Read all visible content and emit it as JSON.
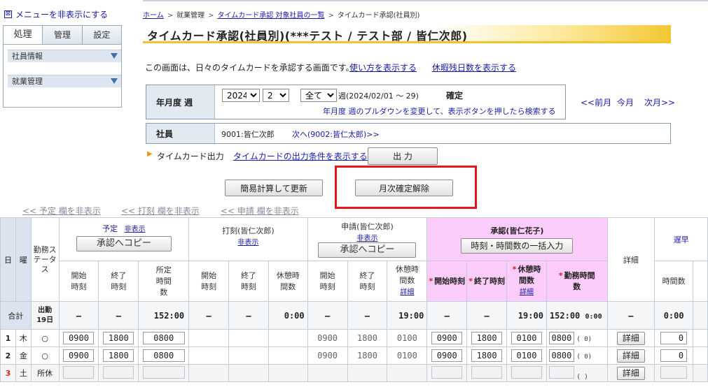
{
  "sidebar": {
    "toggle_label": "メニューを非表示にする",
    "tabs": [
      "処理",
      "管理",
      "設定"
    ],
    "items": [
      "社員情報",
      "就業管理"
    ]
  },
  "breadcrumb": {
    "home": "ホーム",
    "level1": "就業管理",
    "level2": "タイムカード承認 対象社員の一覧",
    "current": "タイムカード承認(社員別)",
    "separator": ">"
  },
  "page_title": "タイムカード承認(社員別)(***テスト / テスト部 / 皆仁次郎)",
  "description": "この画面は、日々のタイムカードを承認する画面です。",
  "links": {
    "how_to": "使い方を表示する",
    "leave_days": "休暇残日数を表示する",
    "output_conditions": "タイムカードの出力条件を表示する"
  },
  "filter": {
    "period_label": "年月度 週",
    "year": "2024",
    "month": "2",
    "week": "全て",
    "range_text": "週(2024/02/01 〜 29)",
    "status": "確定",
    "hint": "年月度 週のプルダウンを変更して、表示ボタンを押したら検索する",
    "prev_month": "<<前月",
    "this_month": "今月",
    "next_month": "次月>>",
    "employee_label": "社員",
    "employee": "9001:皆仁次郎",
    "next_employee": "次へ(9002:皆仁太郎)>>"
  },
  "output": {
    "label": "タイムカード出力",
    "button": "出 力"
  },
  "buttons": {
    "simple_calc": "簡易計算して更新",
    "unlock_month": "月次確定解除"
  },
  "column_toggles": {
    "plan": "<< 予定 欄を非表示",
    "punch": "<< 打刻 欄を非表示",
    "apply": "<< 申請 欄を非表示"
  },
  "grid": {
    "headers": {
      "day": "日",
      "weekday": "曜",
      "status": "勤務ステータス",
      "plan_title": "予定",
      "hide": "非表示",
      "copy_to_approve": "承認へコピー",
      "punch_title": "打刻(皆仁次郎)",
      "apply_title": "申請(皆仁次郎)",
      "approve_title": "承認(皆仁花子)",
      "bulk_input": "時刻・時間数の一括入力",
      "detail": "詳細",
      "late": "遅早",
      "start": "開始時刻",
      "end": "終了時刻",
      "scheduled": "所定時間数",
      "break_hours": "休憩時間数",
      "break_detail": "詳細",
      "work_hours": "勤務時間数",
      "hours": "時間数",
      "star": "*"
    },
    "totals": {
      "label": "合計",
      "attend_label": "出勤",
      "attend_days": "19日",
      "dash": "–",
      "plan_scheduled": "152:00",
      "punch_break": "0:00",
      "apply_break": "19:00",
      "approve_break": "19:00",
      "approve_work": "152:00",
      "approve_work_sub": "0:00",
      "late": "0:00"
    },
    "rows": [
      {
        "day": "1",
        "weekday": "木",
        "status": "○",
        "plan_start": "0900",
        "plan_end": "1800",
        "plan_sched": "0800",
        "apply_start": "0900",
        "apply_end": "1800",
        "apply_break": "0100",
        "appr_start": "0900",
        "appr_end": "1800",
        "appr_break": "0100",
        "appr_work": "0800",
        "paren": "( 0)",
        "detail": "詳細",
        "late": "0"
      },
      {
        "day": "2",
        "weekday": "金",
        "status": "○",
        "plan_start": "0900",
        "plan_end": "1800",
        "plan_sched": "0800",
        "apply_start": "0900",
        "apply_end": "1800",
        "apply_break": "0100",
        "appr_start": "0900",
        "appr_end": "1800",
        "appr_break": "0100",
        "appr_work": "0800",
        "paren": "( 0)",
        "detail": "詳細",
        "late": "0"
      },
      {
        "day": "3",
        "weekday": "土",
        "status": "所休",
        "paren": "(  )",
        "detail": "詳細"
      }
    ]
  }
}
